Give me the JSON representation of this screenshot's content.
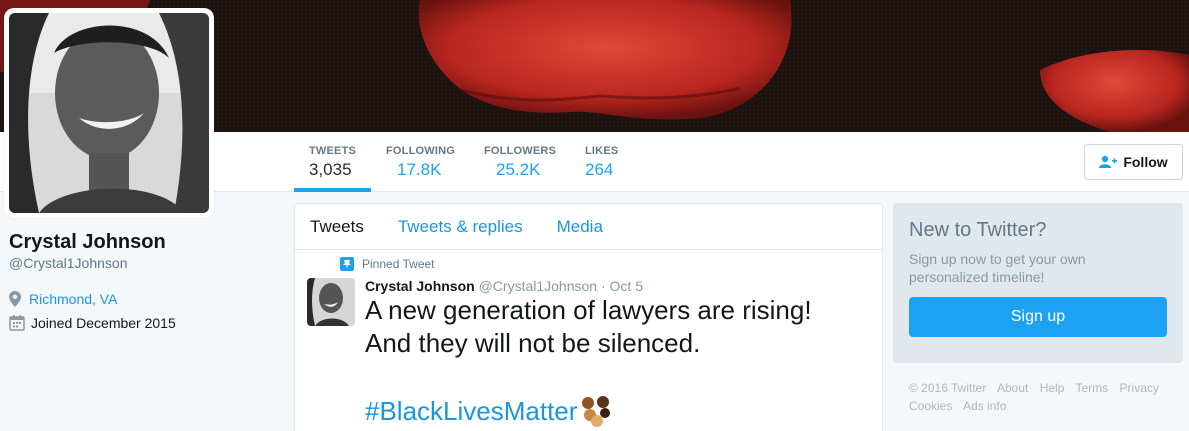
{
  "profile": {
    "name": "Crystal Johnson",
    "handle": "@Crystal1Johnson",
    "location": "Richmond, VA",
    "joined": "Joined December 2015"
  },
  "stats": [
    {
      "label": "TWEETS",
      "value": "3,035",
      "active": true
    },
    {
      "label": "FOLLOWING",
      "value": "17.8K",
      "active": false
    },
    {
      "label": "FOLLOWERS",
      "value": "25.2K",
      "active": false
    },
    {
      "label": "LIKES",
      "value": "264",
      "active": false
    }
  ],
  "follow_button": {
    "label": "Follow",
    "icon": "add-user-icon"
  },
  "timeline": {
    "tabs": [
      "Tweets",
      "Tweets & replies",
      "Media"
    ],
    "pinned_label": "Pinned Tweet",
    "tweet": {
      "name": "Crystal Johnson",
      "handle": "@Crystal1Johnson",
      "date": "· Oct 5",
      "text_line1": "A new generation of lawyers are rising!",
      "text_line2": "And they will not be silenced.",
      "hashtag": "#BlackLivesMatter"
    }
  },
  "signup": {
    "title": "New to Twitter?",
    "subtitle": "Sign up now to get your own personalized timeline!",
    "button": "Sign up"
  },
  "footer": {
    "links": [
      "© 2016 Twitter",
      "About",
      "Help",
      "Terms",
      "Privacy",
      "Cookies",
      "Ads info"
    ]
  },
  "colors": {
    "accent": "#1da1f2",
    "link": "#1b95e0",
    "background": "#f5f8fa"
  }
}
